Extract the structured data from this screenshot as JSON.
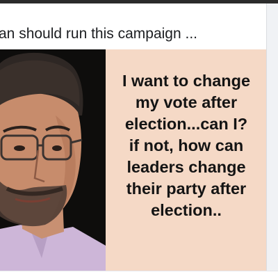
{
  "post": {
    "caption": "an should run this campaign ..."
  },
  "meme": {
    "lines": [
      "I want to change",
      "my vote after",
      "election...can I?",
      "if not, how can",
      "leaders change",
      "their party after",
      "election.."
    ]
  }
}
